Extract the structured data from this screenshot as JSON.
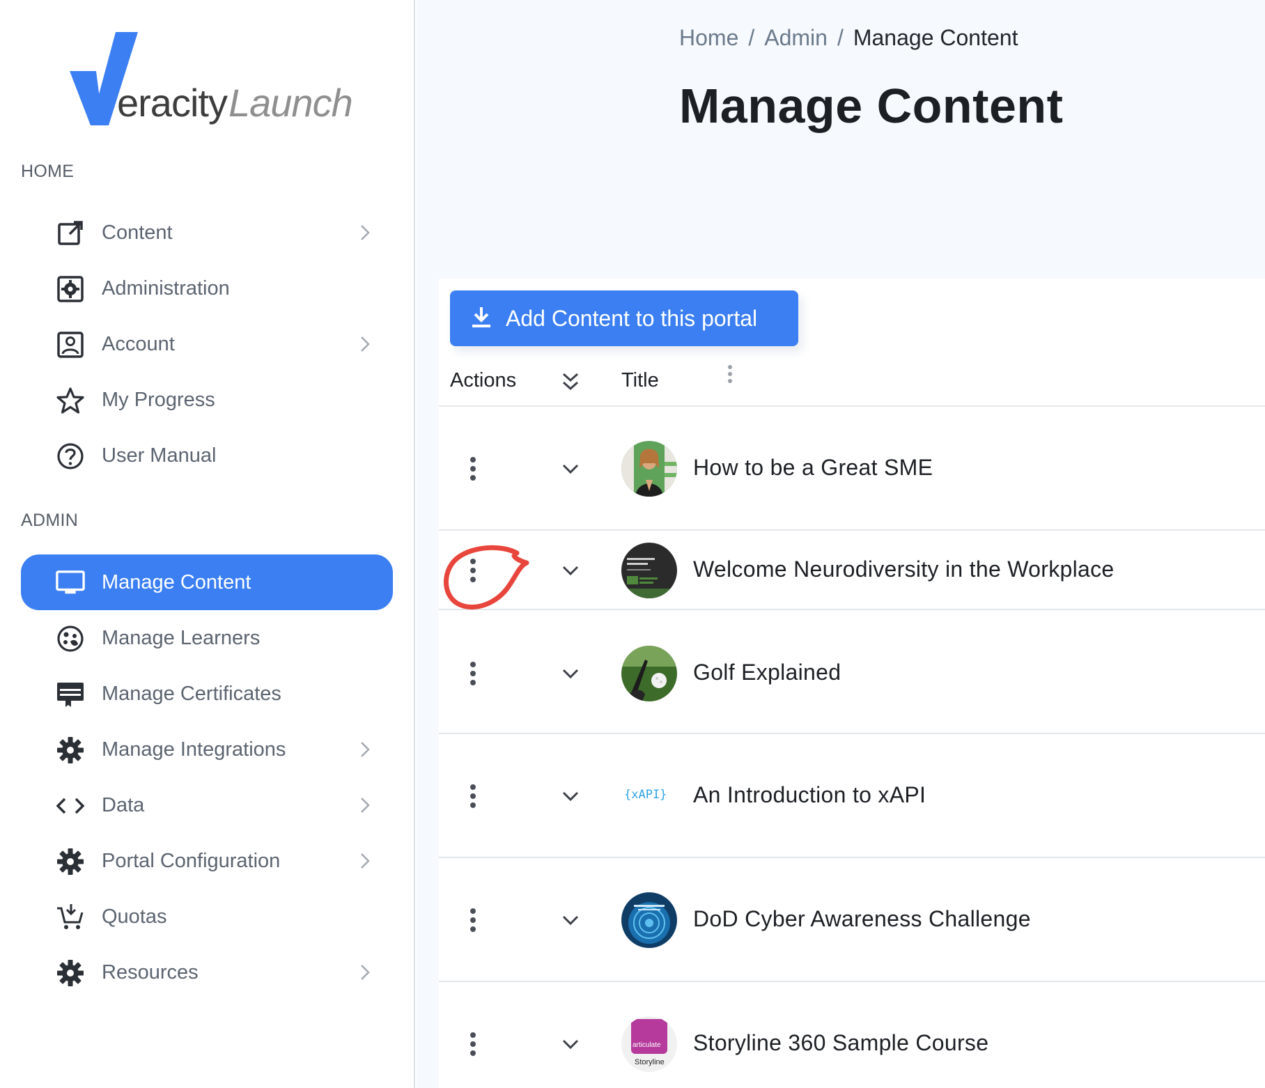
{
  "sidebar": {
    "logo": {
      "word1": "eracity",
      "word2": "Launch",
      "accent": "#3b7ff3"
    },
    "sections": [
      {
        "label": "HOME"
      },
      {
        "label": "ADMIN"
      }
    ],
    "home_items": [
      {
        "label": "Content",
        "icon": "external-link-icon",
        "has_chevron": true
      },
      {
        "label": "Administration",
        "icon": "admin-gear-box-icon",
        "has_chevron": false
      },
      {
        "label": "Account",
        "icon": "account-box-icon",
        "has_chevron": true
      },
      {
        "label": "My Progress",
        "icon": "star-icon",
        "has_chevron": false
      },
      {
        "label": "User Manual",
        "icon": "help-circle-icon",
        "has_chevron": false
      }
    ],
    "admin_items": [
      {
        "label": "Manage Content",
        "icon": "monitor-icon",
        "has_chevron": false,
        "active": true
      },
      {
        "label": "Manage Learners",
        "icon": "learners-icon",
        "has_chevron": false
      },
      {
        "label": "Manage Certificates",
        "icon": "certificate-icon",
        "has_chevron": false
      },
      {
        "label": "Manage Integrations",
        "icon": "gear-icon",
        "has_chevron": true
      },
      {
        "label": "Data",
        "icon": "code-icon",
        "has_chevron": true
      },
      {
        "label": "Portal Configuration",
        "icon": "gear-icon",
        "has_chevron": true
      },
      {
        "label": "Quotas",
        "icon": "cart-icon",
        "has_chevron": false
      },
      {
        "label": "Resources",
        "icon": "gear-icon",
        "has_chevron": true
      }
    ]
  },
  "breadcrumb": {
    "items": [
      "Home",
      "Admin"
    ],
    "separator": "/",
    "current": "Manage Content"
  },
  "page": {
    "title": "Manage Content"
  },
  "toolbar": {
    "add_label": "Add Content to this portal",
    "add_icon": "download-icon"
  },
  "table": {
    "headers": {
      "actions": "Actions",
      "title": "Title"
    },
    "rows": [
      {
        "title": "How to be a Great SME",
        "thumb": "person-photo"
      },
      {
        "title": "Welcome Neurodiversity in the Workplace",
        "thumb": "dark-slide",
        "annotated": true
      },
      {
        "title": "Golf Explained",
        "thumb": "golf-ball"
      },
      {
        "title": "An Introduction to xAPI",
        "thumb": "xapi-logo",
        "thumb_text": "{xAPI}"
      },
      {
        "title": "DoD Cyber Awareness Challenge",
        "thumb": "cyber-blue"
      },
      {
        "title": "Storyline 360 Sample Course",
        "thumb": "articulate-storyline",
        "thumb_text": "articulate",
        "thumb_caption": "Storyline"
      }
    ]
  },
  "colors": {
    "accent": "#3b7ff3",
    "annotation": "#e8453c",
    "muted_text": "#5b6470",
    "main_bg": "#f6f9fd"
  }
}
